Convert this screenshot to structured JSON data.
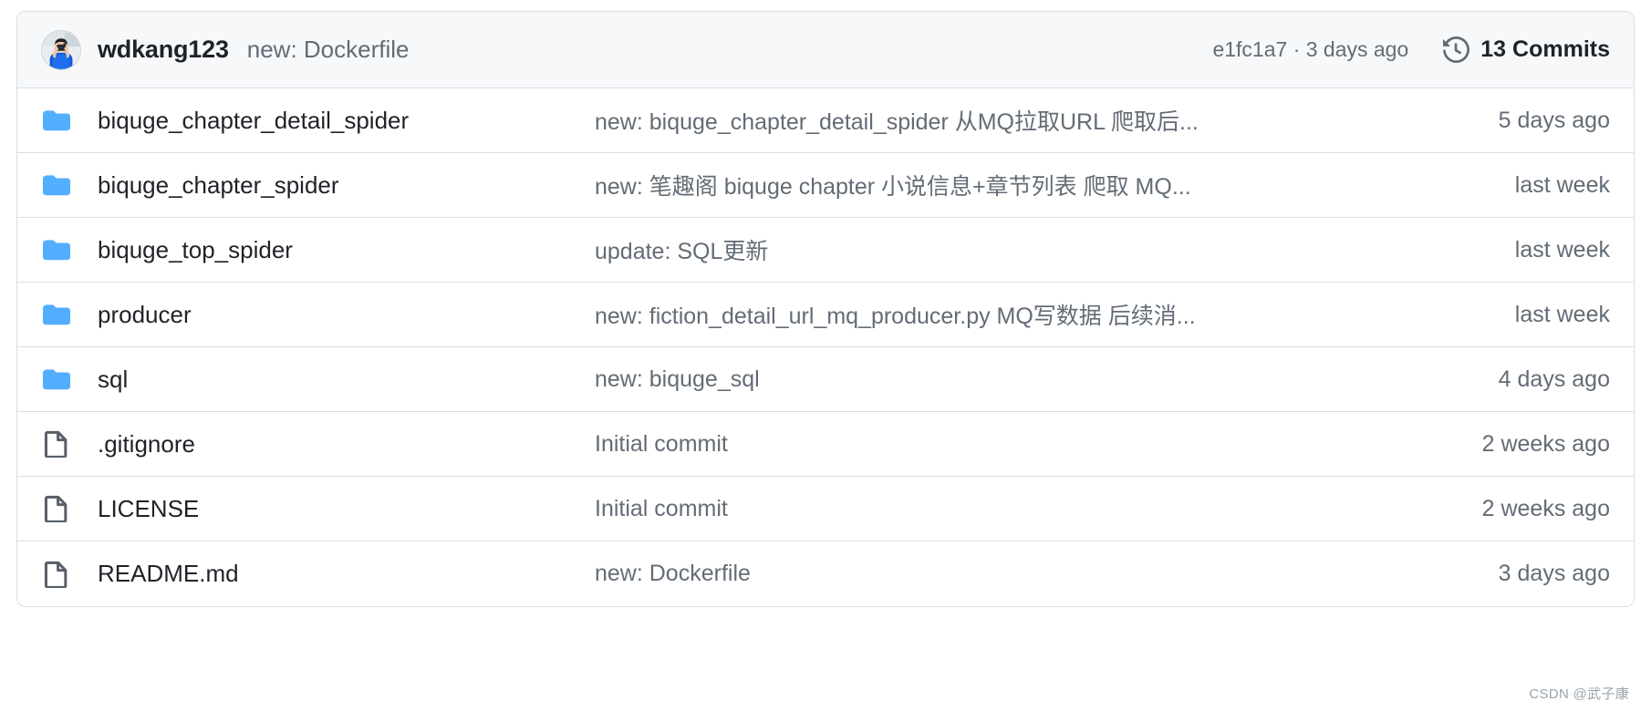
{
  "header": {
    "avatar_name": "user-avatar-photo",
    "author": "wdkang123",
    "commit_message": "new: Dockerfile",
    "commit_meta": "e1fc1a7 · 3 days ago",
    "commits_icon": "history-icon",
    "commits_label": "13 Commits",
    "background_color": "#f6f8fa",
    "border_color": "#d8dee4"
  },
  "colors": {
    "folder_blue": "#54aeff",
    "file_gray": "#57606a",
    "text_primary": "#1f2328",
    "text_muted": "#636c76"
  },
  "files": [
    {
      "icon": "folder-icon",
      "type": "folder",
      "name": "biquge_chapter_detail_spider",
      "commit": "new: biquge_chapter_detail_spider 从MQ拉取URL 爬取后...",
      "time": "5 days ago"
    },
    {
      "icon": "folder-icon",
      "type": "folder",
      "name": "biquge_chapter_spider",
      "commit": "new: 笔趣阁 biquge chapter 小说信息+章节列表 爬取 MQ...",
      "time": "last week"
    },
    {
      "icon": "folder-icon",
      "type": "folder",
      "name": "biquge_top_spider",
      "commit": "update: SQL更新",
      "time": "last week"
    },
    {
      "icon": "folder-icon",
      "type": "folder",
      "name": "producer",
      "commit": "new: fiction_detail_url_mq_producer.py MQ写数据 后续消...",
      "time": "last week"
    },
    {
      "icon": "folder-icon",
      "type": "folder",
      "name": "sql",
      "commit": "new: biquge_sql",
      "time": "4 days ago"
    },
    {
      "icon": "file-icon",
      "type": "file",
      "name": ".gitignore",
      "commit": "Initial commit",
      "time": "2 weeks ago"
    },
    {
      "icon": "file-icon",
      "type": "file",
      "name": "LICENSE",
      "commit": "Initial commit",
      "time": "2 weeks ago"
    },
    {
      "icon": "file-icon",
      "type": "file",
      "name": "README.md",
      "commit": "new: Dockerfile",
      "time": "3 days ago"
    }
  ],
  "watermark": "CSDN @武子康"
}
